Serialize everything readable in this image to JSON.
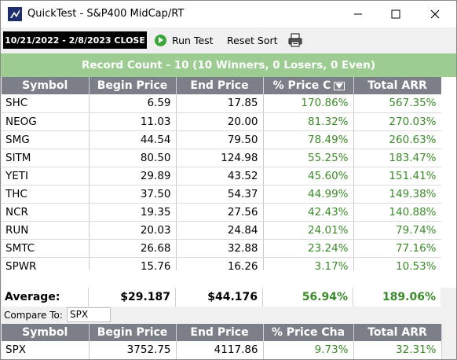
{
  "window": {
    "title": "QuickTest - S&P400 MidCap/RT",
    "min_icon": "minimize-icon",
    "max_icon": "maximize-icon",
    "close_icon": "close-icon"
  },
  "toolbar": {
    "date_range": "10/21/2022 - 2/8/2023  CLOSE",
    "run_label": "Run Test",
    "reset_label": "Reset Sort",
    "print_icon": "printer-icon"
  },
  "record_summary": "Record Count - 10 (10 Winners, 0 Losers, 0 Even)",
  "columns": [
    "Symbol",
    "Begin Price",
    "End Price",
    "% Price C",
    "Total ARR"
  ],
  "rows": [
    {
      "symbol": "SHC",
      "begin": "6.59",
      "end": "17.85",
      "pct": "170.86%",
      "arr": "567.35%"
    },
    {
      "symbol": "NEOG",
      "begin": "11.03",
      "end": "20.00",
      "pct": "81.32%",
      "arr": "270.03%"
    },
    {
      "symbol": "SMG",
      "begin": "44.54",
      "end": "79.50",
      "pct": "78.49%",
      "arr": "260.63%"
    },
    {
      "symbol": "SITM",
      "begin": "80.50",
      "end": "124.98",
      "pct": "55.25%",
      "arr": "183.47%"
    },
    {
      "symbol": "YETI",
      "begin": "29.89",
      "end": "43.52",
      "pct": "45.60%",
      "arr": "151.41%"
    },
    {
      "symbol": "THC",
      "begin": "37.50",
      "end": "54.37",
      "pct": "44.99%",
      "arr": "149.38%"
    },
    {
      "symbol": "NCR",
      "begin": "19.35",
      "end": "27.56",
      "pct": "42.43%",
      "arr": "140.88%"
    },
    {
      "symbol": "RUN",
      "begin": "20.03",
      "end": "24.84",
      "pct": "24.01%",
      "arr": "79.74%"
    },
    {
      "symbol": "SMTC",
      "begin": "26.68",
      "end": "32.88",
      "pct": "23.24%",
      "arr": "77.16%"
    },
    {
      "symbol": "SPWR",
      "begin": "15.76",
      "end": "16.26",
      "pct": "3.17%",
      "arr": "10.53%"
    }
  ],
  "average": {
    "label": "Average:",
    "begin": "$29.187",
    "end": "$44.176",
    "pct": "56.94%",
    "arr": "189.06%"
  },
  "compare": {
    "label": "Compare To:",
    "value": "SPX",
    "columns": [
      "Symbol",
      "Begin Price",
      "End Price",
      "% Price Cha",
      "Total ARR"
    ],
    "row": {
      "symbol": "SPX",
      "begin": "3752.75",
      "end": "4117.86",
      "pct": "9.73%",
      "arr": "32.31%"
    }
  },
  "colors": {
    "header_gray": "#7b8088",
    "record_green": "#9ccc91",
    "positive_green": "#3b8a2a"
  }
}
